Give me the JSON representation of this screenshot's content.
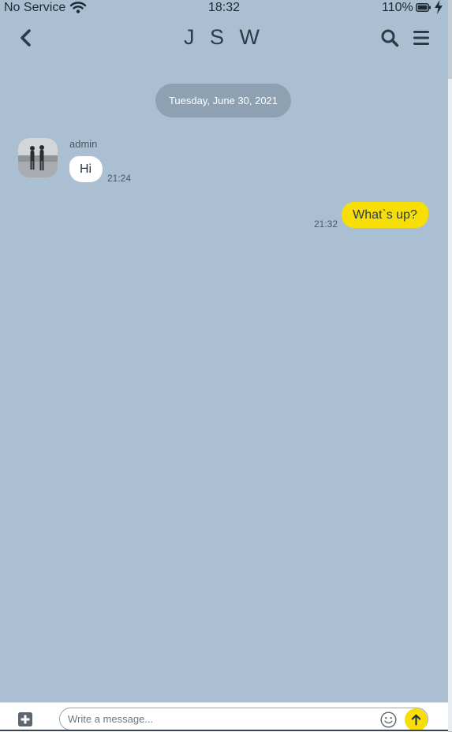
{
  "status_bar": {
    "carrier": "No Service",
    "time": "18:32",
    "battery_percent": "110%",
    "wifi_icon": "wifi-icon",
    "battery_icon": "battery-icon",
    "charging_icon": "lightning-bolt-icon"
  },
  "header": {
    "title": "J S W",
    "back_icon": "chevron-left-icon",
    "search_icon": "search-icon",
    "menu_icon": "hamburger-menu-icon"
  },
  "chat": {
    "date_separator": "Tuesday, June 30, 2021",
    "messages": [
      {
        "direction": "incoming",
        "sender": "admin",
        "text": "Hi",
        "time": "21:24",
        "avatar_icon": "avatar-photo"
      },
      {
        "direction": "outgoing",
        "text": "What`s up?",
        "time": "21:32"
      }
    ]
  },
  "composer": {
    "placeholder": "Write a message...",
    "value": "",
    "attach_icon": "plus-square-icon",
    "emoji_icon": "smiley-icon",
    "send_icon": "arrow-up-icon"
  },
  "colors": {
    "background": "#aabfd1",
    "incoming_bubble": "#ffffff",
    "outgoing_bubble": "#f7df06",
    "date_pill": "#8da1b2",
    "send_button": "#f7df06"
  }
}
